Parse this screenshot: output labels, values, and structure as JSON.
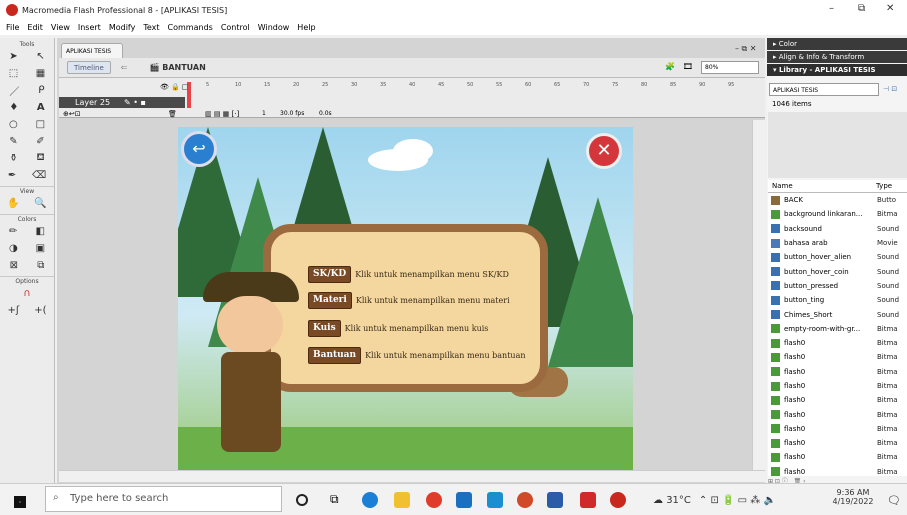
{
  "window": {
    "title": "Macromedia Flash Professional 8 - [APLIKASI TESIS]",
    "minimize": "–",
    "restore": "⧉",
    "close": "✕"
  },
  "menu": [
    "File",
    "Edit",
    "View",
    "Insert",
    "Modify",
    "Text",
    "Commands",
    "Control",
    "Window",
    "Help"
  ],
  "tools": {
    "header": "Tools",
    "view": "View",
    "colors": "Colors",
    "options": "Options"
  },
  "document": {
    "tab": "APLIKASI TESIS",
    "timeline_button": "Timeline",
    "scene": "BANTUAN",
    "zoom": "80%",
    "controls": "– ⧉ ✕"
  },
  "timeline": {
    "layer": "Layer 25",
    "frame": "1",
    "fps": "30.0 fps",
    "time": "0.0s",
    "ruler": [
      "5",
      "10",
      "15",
      "20",
      "25",
      "30",
      "35",
      "40",
      "45",
      "50",
      "55",
      "60",
      "65",
      "70",
      "75",
      "80",
      "85",
      "90",
      "95"
    ]
  },
  "stage": {
    "back_icon": "back-arrow-icon",
    "close_icon": "close-icon",
    "menu_items": [
      {
        "label": "SK/KD",
        "desc": "Klik untuk menampilkan  menu SK/KD"
      },
      {
        "label": "Materi",
        "desc": "Klik untuk menampilkan  menu materi"
      },
      {
        "label": "Kuis",
        "desc": "Klik untuk menampilkan  menu kuis"
      },
      {
        "label": "Bantuan",
        "desc": "Klik untuk menampilkan  menu bantuan"
      }
    ]
  },
  "panels": {
    "color": "Color",
    "align": "Align & Info & Transform",
    "library": "Library - APLIKASI TESIS"
  },
  "library": {
    "selected": "APLIKASI TESIS",
    "count": "1046 items",
    "col_name": "Name",
    "col_type": "Type",
    "items": [
      {
        "name": "BACK",
        "type": "Butto",
        "icon": "button-icon"
      },
      {
        "name": "background linkaran...",
        "type": "Bitma",
        "icon": "bitmap-icon"
      },
      {
        "name": "backsound",
        "type": "Sound",
        "icon": "sound-icon"
      },
      {
        "name": "bahasa arab",
        "type": "Movie",
        "icon": "movie-icon"
      },
      {
        "name": "button_hover_alien",
        "type": "Sound",
        "icon": "sound-icon"
      },
      {
        "name": "button_hover_coin",
        "type": "Sound",
        "icon": "sound-icon"
      },
      {
        "name": "button_pressed",
        "type": "Sound",
        "icon": "sound-icon"
      },
      {
        "name": "button_ting",
        "type": "Sound",
        "icon": "sound-icon"
      },
      {
        "name": "Chimes_Short",
        "type": "Sound",
        "icon": "sound-icon"
      },
      {
        "name": "empty-room-with-gr...",
        "type": "Bitma",
        "icon": "bitmap-icon"
      },
      {
        "name": "flash0",
        "type": "Bitma",
        "icon": "bitmap-icon"
      },
      {
        "name": "flash0",
        "type": "Bitma",
        "icon": "bitmap-icon"
      },
      {
        "name": "flash0",
        "type": "Bitma",
        "icon": "bitmap-icon"
      },
      {
        "name": "flash0",
        "type": "Bitma",
        "icon": "bitmap-icon"
      },
      {
        "name": "flash0",
        "type": "Bitma",
        "icon": "bitmap-icon"
      },
      {
        "name": "flash0",
        "type": "Bitma",
        "icon": "bitmap-icon"
      },
      {
        "name": "flash0",
        "type": "Bitma",
        "icon": "bitmap-icon"
      },
      {
        "name": "flash0",
        "type": "Bitma",
        "icon": "bitmap-icon"
      },
      {
        "name": "flash0",
        "type": "Bitma",
        "icon": "bitmap-icon"
      },
      {
        "name": "flash0",
        "type": "Bitma",
        "icon": "bitmap-icon"
      }
    ]
  },
  "taskbar": {
    "search": "Type here to search",
    "temp": "31°C",
    "time": "9:36 AM",
    "date": "4/19/2022"
  },
  "colors": {
    "accent": "#2a7fd0",
    "panel_header": "#3a3a3a",
    "sound_icon": "#3a6fb0",
    "bitmap_icon": "#4a9a3a"
  }
}
